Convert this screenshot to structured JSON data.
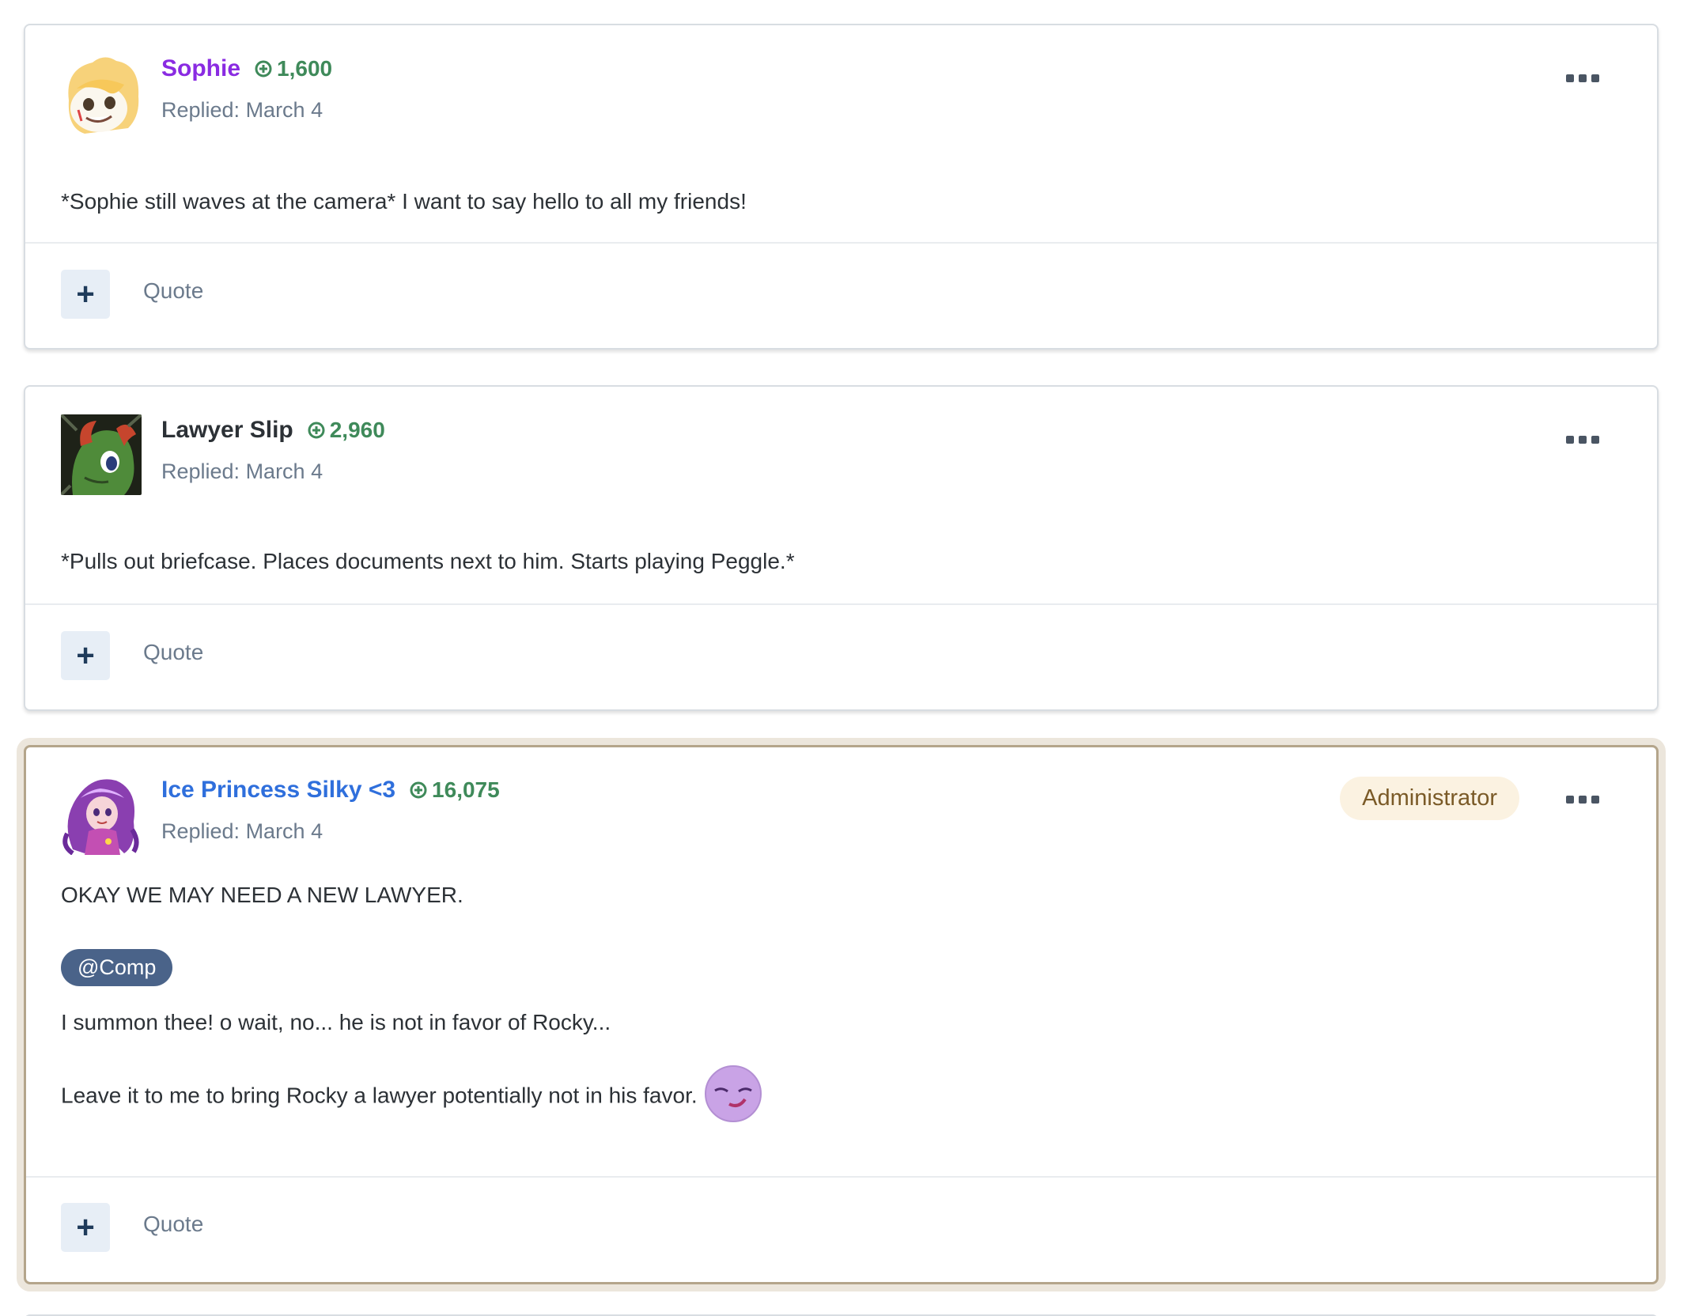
{
  "posts": [
    {
      "author": "Sophie",
      "author_color": "#8a2be2",
      "reputation": "1,600",
      "reply_date": "Replied: March 4",
      "badge": "",
      "avatar": "pony-cream-avatar",
      "body": [
        "*Sophie still waves at the camera* I want to say hello to all my friends!"
      ],
      "react_label": "+",
      "quote_label": "Quote"
    },
    {
      "author": "Lawyer Slip",
      "author_color": "#2c3136",
      "reputation": "2,960",
      "reply_date": "Replied: March 4",
      "badge": "",
      "avatar": "pony-green-avatar",
      "body": [
        "*Pulls out briefcase. Places documents next to him. Starts playing Peggle.*"
      ],
      "react_label": "+",
      "quote_label": "Quote"
    },
    {
      "author": "Ice Princess Silky <3",
      "author_color": "#2f6fdc",
      "reputation": "16,075",
      "reply_date": "Replied: March 4",
      "badge": "Administrator",
      "avatar": "purple-hair-character-avatar",
      "body": [
        "OKAY WE MAY NEED A NEW LAWYER.",
        "I summon thee! o wait, no... he is not in favor of Rocky...",
        "Leave it to me to bring Rocky a lawyer potentially not in his favor."
      ],
      "mention": "@Comp",
      "emoji": "smirk-face-emoji",
      "react_label": "+",
      "quote_label": "Quote"
    }
  ],
  "colors": {
    "reputation": "#3f8a5a",
    "meta_text": "#6b7a8c",
    "mention_bg": "#4a6389",
    "badge_bg": "#fbf2e1",
    "badge_text": "#7a5a27",
    "highlight_border": "#b4a58b"
  }
}
